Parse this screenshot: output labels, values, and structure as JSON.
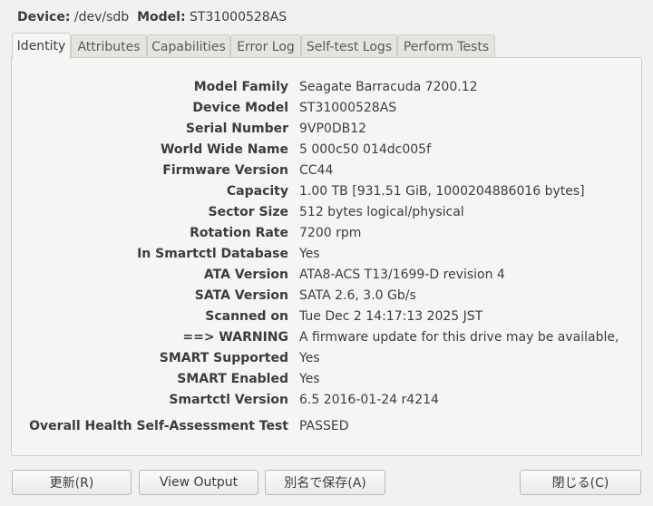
{
  "header": {
    "device_label": "Device:",
    "device": "/dev/sdb",
    "model_label": "Model:",
    "model": "ST31000528AS"
  },
  "tabs": [
    "Identity",
    "Attributes",
    "Capabilities",
    "Error Log",
    "Self-test Logs",
    "Perform Tests"
  ],
  "identity": [
    {
      "label": "Model Family",
      "value": "Seagate Barracuda 7200.12"
    },
    {
      "label": "Device Model",
      "value": "ST31000528AS"
    },
    {
      "label": "Serial Number",
      "value": "9VP0DB12"
    },
    {
      "label": "World Wide Name",
      "value": "5 000c50 014dc005f"
    },
    {
      "label": "Firmware Version",
      "value": "CC44"
    },
    {
      "label": "Capacity",
      "value": "1.00 TB [931.51 GiB, 1000204886016 bytes]"
    },
    {
      "label": "Sector Size",
      "value": "512 bytes logical/physical"
    },
    {
      "label": "Rotation Rate",
      "value": "7200 rpm"
    },
    {
      "label": "In Smartctl Database",
      "value": "Yes"
    },
    {
      "label": "ATA Version",
      "value": "ATA8-ACS T13/1699-D revision 4"
    },
    {
      "label": "SATA Version",
      "value": "SATA 2.6, 3.0 Gb/s"
    },
    {
      "label": "Scanned on",
      "value": "Tue Dec  2 14:17:13 2025 JST"
    },
    {
      "label": "==> WARNING",
      "value": "A firmware update for this drive may be available,"
    },
    {
      "label": "SMART Supported",
      "value": "Yes"
    },
    {
      "label": "SMART Enabled",
      "value": "Yes"
    },
    {
      "label": "Smartctl Version",
      "value": "6.5 2016-01-24 r4214"
    }
  ],
  "health": {
    "label": "Overall Health Self-Assessment Test",
    "value": "PASSED"
  },
  "buttons": {
    "refresh": "更新(R)",
    "view_output": "View Output",
    "save_as": "別名で保存(A)",
    "close": "閉じる(C)"
  }
}
